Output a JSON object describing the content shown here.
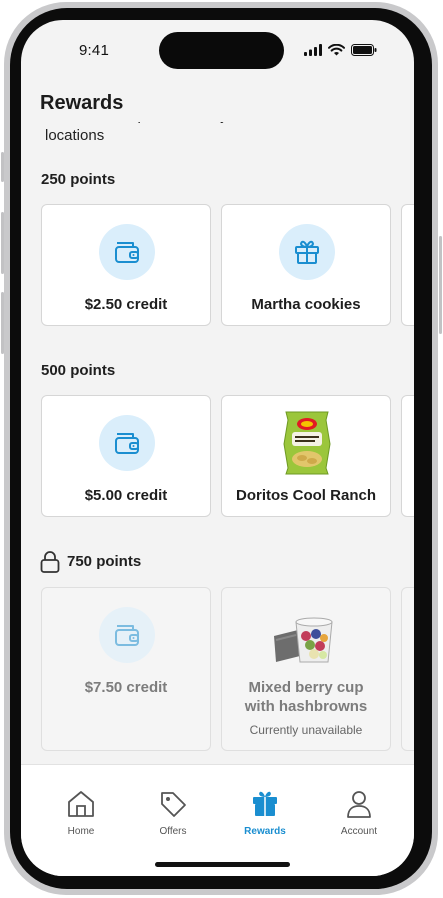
{
  "status_bar": {
    "time": "9:41"
  },
  "page": {
    "title": "Rewards",
    "disclaimer": "Rewards and products may not be available at all locations"
  },
  "sections": [
    {
      "title": "250 points",
      "locked": false,
      "cards": [
        {
          "label": "$2.50 credit",
          "icon": "wallet-icon"
        },
        {
          "label": "Martha cookies",
          "icon": "gift-icon"
        }
      ]
    },
    {
      "title": "500 points",
      "locked": false,
      "cards": [
        {
          "label": "$5.00 credit",
          "icon": "wallet-icon"
        },
        {
          "label": "Doritos Cool Ranch",
          "icon": "chip-bag-image"
        }
      ]
    },
    {
      "title": "750 points",
      "locked": true,
      "cards": [
        {
          "label": "$7.50 credit",
          "icon": "wallet-icon"
        },
        {
          "label": "Mixed berry cup with hashbrowns",
          "icon": "fruit-cup-image",
          "status": "Currently unavailable"
        }
      ]
    }
  ],
  "tab_bar": {
    "tabs": [
      {
        "label": "Home",
        "icon": "home-icon",
        "active": false
      },
      {
        "label": "Offers",
        "icon": "tag-icon",
        "active": false
      },
      {
        "label": "Rewards",
        "icon": "gift-icon",
        "active": true
      },
      {
        "label": "Account",
        "icon": "person-icon",
        "active": false
      }
    ]
  },
  "colors": {
    "accent": "#1a8ed0",
    "icon_circle": "#daeefb",
    "background": "#f3f3f3"
  }
}
